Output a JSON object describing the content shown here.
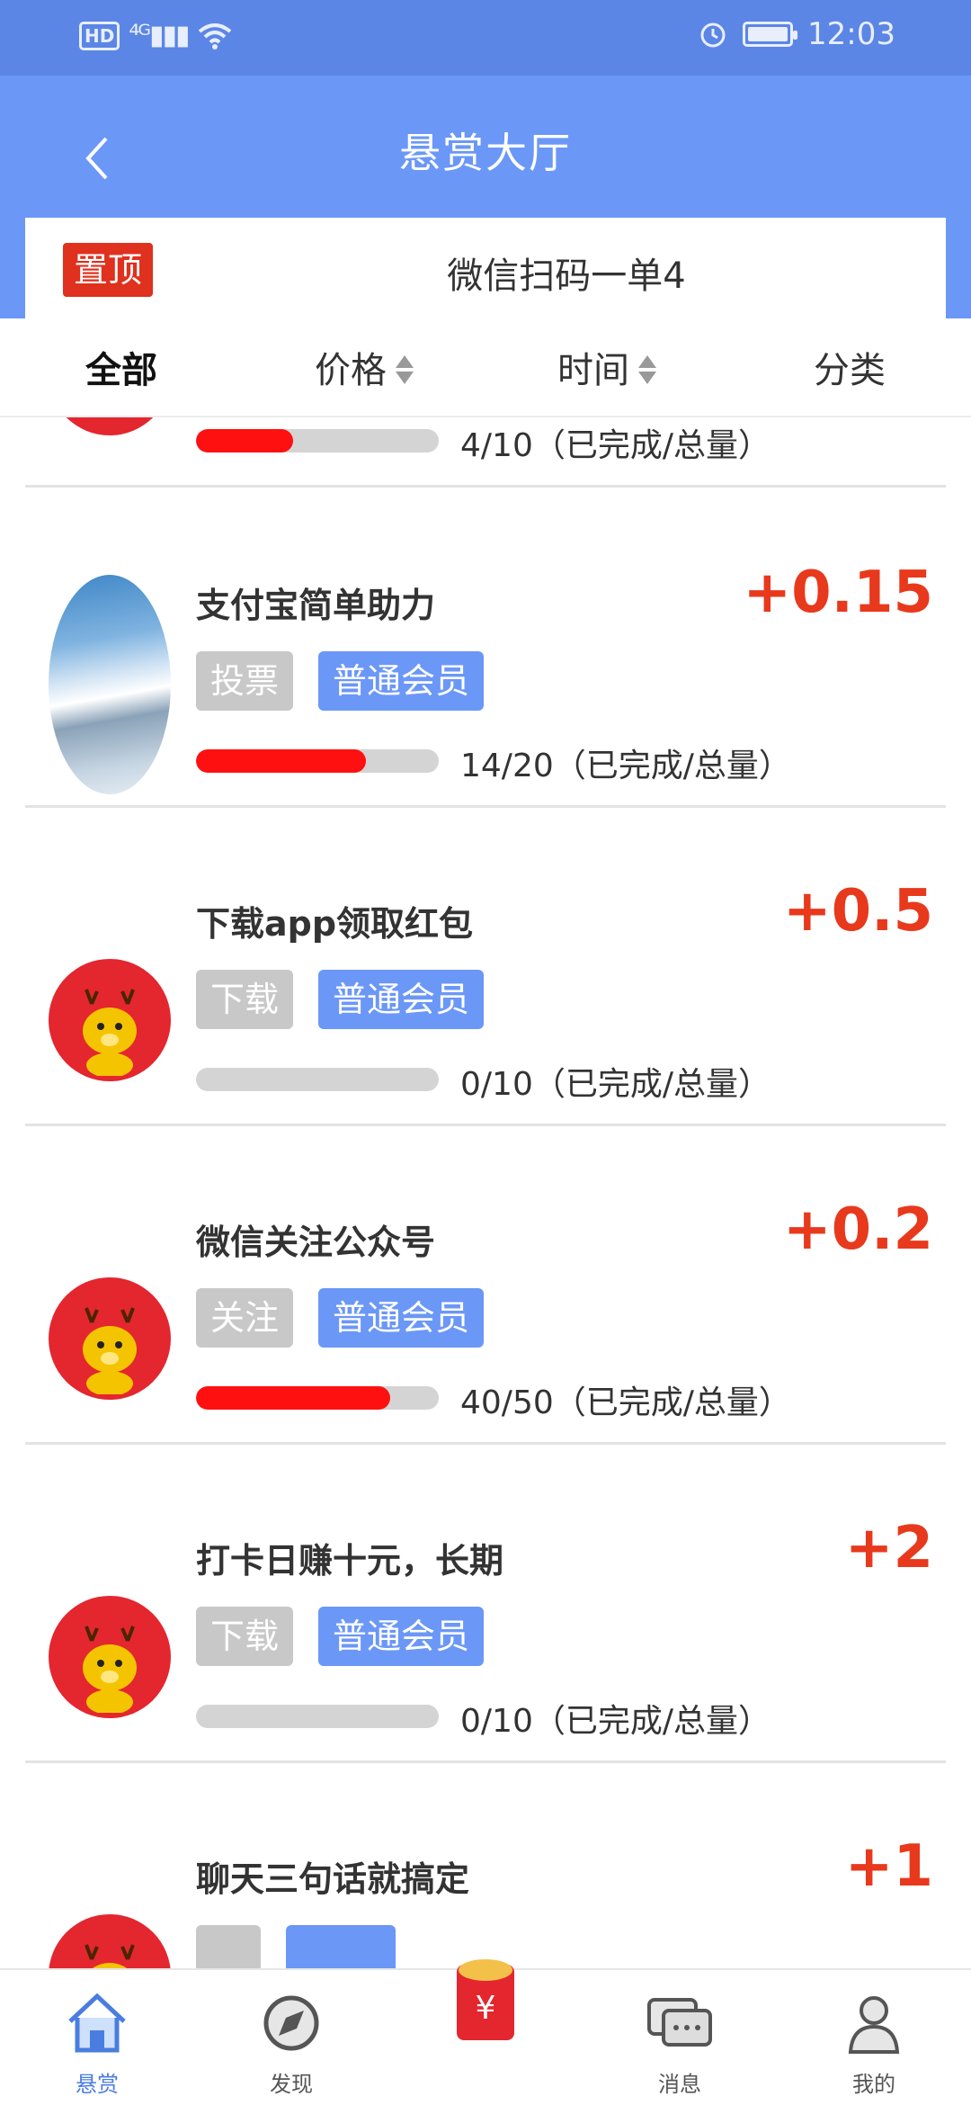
{
  "status_bar": {
    "network": "HD",
    "signal": "⁴ᴳ▮▮▮",
    "time": "12:03"
  },
  "header": {
    "title": "悬赏大厅"
  },
  "pinned": {
    "badge": "置顶",
    "text": "微信扫码一单4"
  },
  "tabs": [
    {
      "label": "全部",
      "active": true
    },
    {
      "label": "价格"
    },
    {
      "label": "时间"
    },
    {
      "label": "分类"
    }
  ],
  "partial_item": {
    "count": "4/10（已完成/总量）",
    "progress": 0.4
  },
  "items": [
    {
      "title": "支付宝简单助力",
      "reward": "+0.15",
      "tag": "投票",
      "level": "普通会员",
      "count": "14/20（已完成/总量）",
      "progress": 0.7,
      "avatar": "snow-mountain-photo"
    },
    {
      "title": "下载app领取红包",
      "reward": "+0.5",
      "tag": "下载",
      "level": "普通会员",
      "count": "0/10（已完成/总量）",
      "progress": 0,
      "avatar": "deer-avatar"
    },
    {
      "title": "微信关注公众号",
      "reward": "+0.2",
      "tag": "关注",
      "level": "普通会员",
      "count": "40/50（已完成/总量）",
      "progress": 0.8,
      "avatar": "deer-avatar"
    },
    {
      "title": "打卡日赚十元，长期",
      "reward": "+2",
      "tag": "下载",
      "level": "普通会员",
      "count": "0/10（已完成/总量）",
      "progress": 0,
      "avatar": "deer-avatar"
    },
    {
      "title": "聊天三句话就搞定",
      "reward": "+1",
      "tag": "",
      "level": "",
      "count": "",
      "progress": 0,
      "avatar": "deer-avatar"
    }
  ],
  "bottom_nav": [
    {
      "label": "悬赏",
      "icon": "home-icon",
      "active": true
    },
    {
      "label": "发现",
      "icon": "discover-icon"
    },
    {
      "label": "",
      "icon": "red-envelope-icon"
    },
    {
      "label": "消息",
      "icon": "message-icon"
    },
    {
      "label": "我的",
      "icon": "profile-icon"
    }
  ],
  "colors": {
    "primary": "#6b97f7",
    "status_bar": "#5b86e5",
    "reward": "#e8391d",
    "progress": "#ff1010",
    "badge": "#e0301e"
  }
}
